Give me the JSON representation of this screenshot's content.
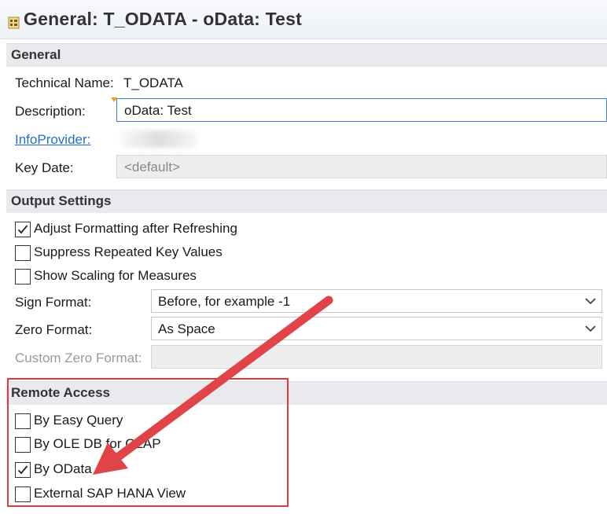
{
  "window": {
    "title": "General: T_ODATA - oData: Test",
    "icon": "query-icon"
  },
  "general": {
    "header": "General",
    "technical_name_label": "Technical Name:",
    "technical_name_value": "T_ODATA",
    "description_label": "Description:",
    "description_value": "oData: Test",
    "infoprovider_label": "InfoProvider:",
    "key_date_label": "Key Date:",
    "key_date_value": "<default>"
  },
  "output_settings": {
    "header": "Output Settings",
    "checkboxes": [
      {
        "label": "Adjust Formatting after Refreshing",
        "checked": true
      },
      {
        "label": "Suppress Repeated Key Values",
        "checked": false
      },
      {
        "label": "Show Scaling for Measures",
        "checked": false
      }
    ],
    "sign_format_label": "Sign Format:",
    "sign_format_value": "Before, for example -1",
    "zero_format_label": "Zero Format:",
    "zero_format_value": "As Space",
    "custom_zero_format_label": "Custom Zero Format:"
  },
  "remote_access": {
    "header": "Remote Access",
    "checkboxes": [
      {
        "label": "By Easy Query",
        "checked": false
      },
      {
        "label": "By OLE DB for OLAP",
        "checked": false
      },
      {
        "label": "By OData",
        "checked": true
      },
      {
        "label": "External SAP HANA View",
        "checked": false
      }
    ]
  },
  "colors": {
    "highlight": "#e0393e",
    "arrow": "#e04448",
    "link": "#1f6fc5"
  }
}
